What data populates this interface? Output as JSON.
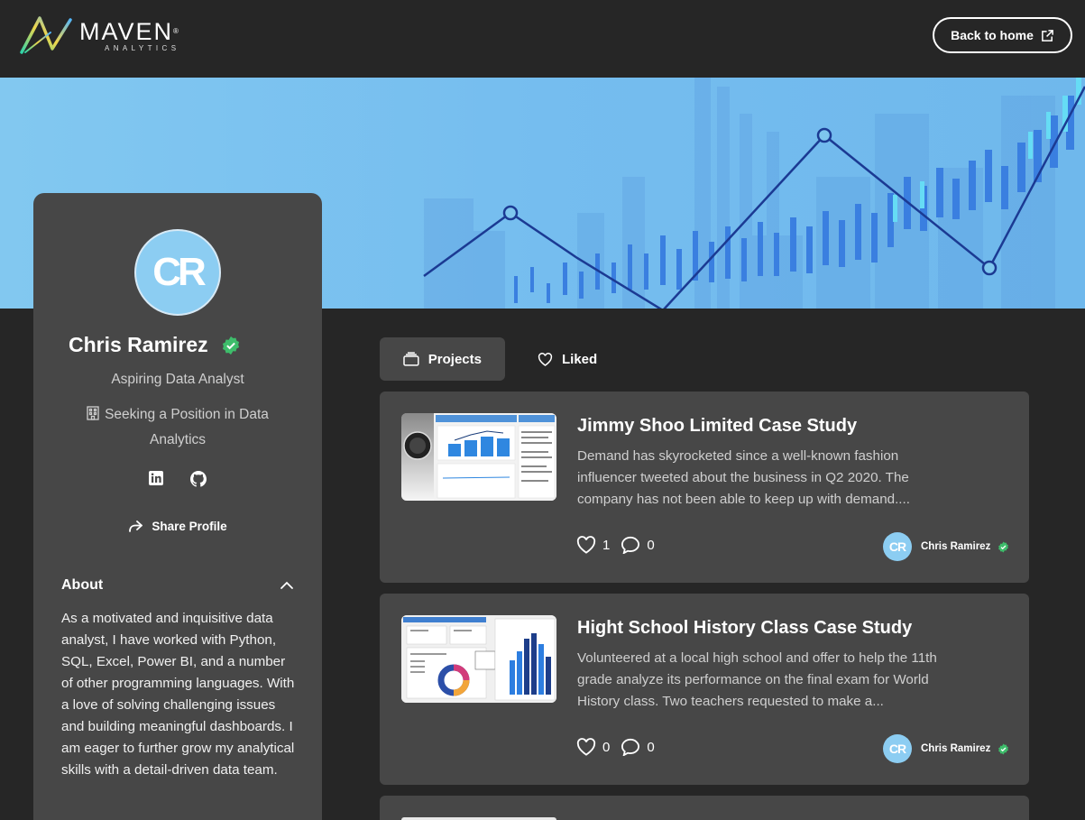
{
  "header": {
    "logo_word": "MAVEN",
    "logo_reg": "®",
    "logo_sub": "ANALYTICS",
    "back_label": "Back to home"
  },
  "profile": {
    "initials": "CR",
    "name": "Chris Ramirez",
    "headline": "Aspiring Data Analyst",
    "seeking": "Seeking a Position in Data Analytics",
    "share_label": "Share Profile",
    "about_title": "About",
    "about_text": "As a motivated and inquisitive data analyst, I have worked with Python, SQL, Excel, Power BI, and a number of other programming languages. With a love of solving challenging issues and building meaningful dashboards. I am eager to further grow my analytical skills with a detail-driven data team."
  },
  "tabs": [
    {
      "label": "Projects",
      "active": true
    },
    {
      "label": "Liked",
      "active": false
    }
  ],
  "projects": [
    {
      "title": "Jimmy Shoo Limited Case Study",
      "description": "Demand has skyrocketed since a well-known fashion influencer tweeted about the business in Q2 2020. The company has not been able to keep up with demand....",
      "likes": "1",
      "comments": "0",
      "author": "Chris Ramirez",
      "author_initials": "CR"
    },
    {
      "title": "Hight School History Class Case Study",
      "description": "Volunteered at a local high school and offer to help the 11th grade analyze its performance on the final exam for World History class. Two teachers requested to make a...",
      "likes": "0",
      "comments": "0",
      "author": "Chris Ramirez",
      "author_initials": "CR"
    }
  ],
  "colors": {
    "page_bg": "#262626",
    "panel_bg": "#474747",
    "accent_blue": "#8ccdf2",
    "verified_green": "#3ebd6b"
  }
}
